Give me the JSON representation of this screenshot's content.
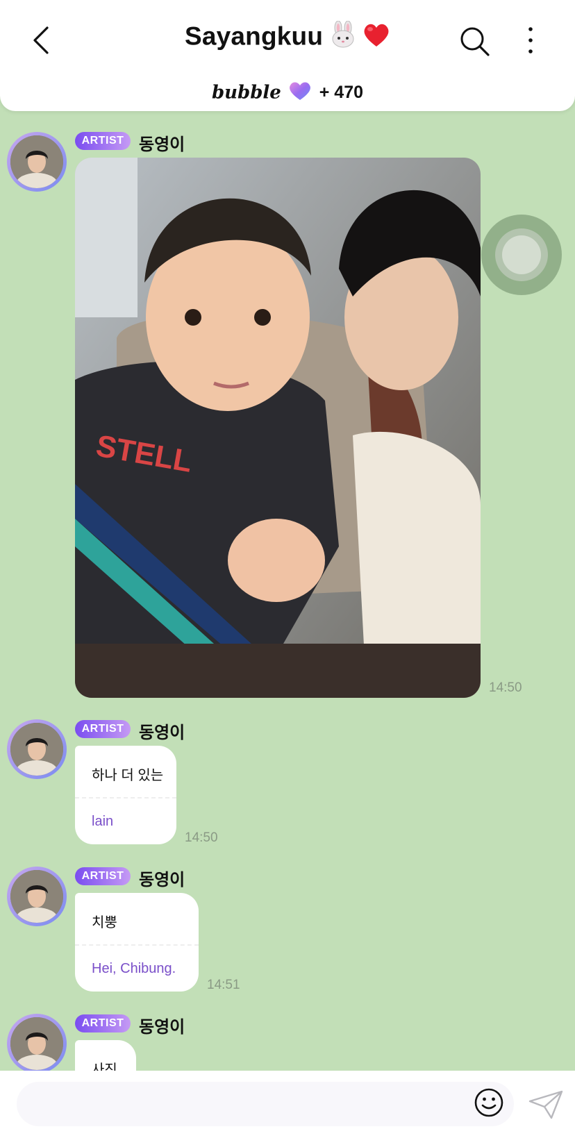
{
  "header": {
    "title": "Sayangkuu",
    "title_emojis": [
      "rabbit-face",
      "red-heart"
    ],
    "bubble_logo": "bubble",
    "bubble_count": "+ 470"
  },
  "messages": [
    {
      "badge": "ARTIST",
      "sender": "동영이",
      "type": "photo",
      "time": "14:50"
    },
    {
      "badge": "ARTIST",
      "sender": "동영이",
      "type": "text",
      "text": "하나 더 있는",
      "translation": "lain",
      "time": "14:50"
    },
    {
      "badge": "ARTIST",
      "sender": "동영이",
      "type": "text",
      "text": "치뿡",
      "translation": "Hei, Chibung.",
      "time": "14:51"
    },
    {
      "badge": "ARTIST",
      "sender": "동영이",
      "type": "text",
      "text": "사진"
    }
  ],
  "colors": {
    "chat_background": "#c2dfb7",
    "badge_gradient_start": "#7a4df0",
    "badge_gradient_end": "#c59af4",
    "translation_text": "#7a4fc9"
  }
}
